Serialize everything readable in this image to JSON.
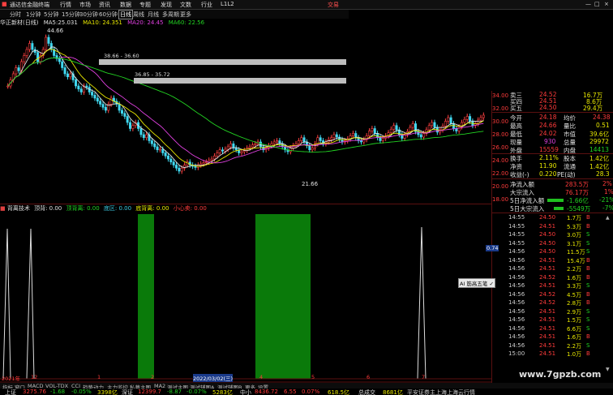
{
  "topbar": {
    "app_title": "通达信金融终端",
    "menus": [
      "行情",
      "市场",
      "资讯",
      "数据",
      "专题",
      "发现",
      "文数",
      "行业",
      "L1L2"
    ],
    "broker": "交易"
  },
  "periods": [
    "分时",
    "1分钟",
    "5分钟",
    "15分钟",
    "30分钟",
    "60分钟",
    "日线",
    "周线",
    "月线",
    "多周期",
    "更多"
  ],
  "active_period": "日线",
  "kline": {
    "title": "华正新材(日线)",
    "ma_label": "MA5:",
    "ma5": "25.031",
    "ma10": "MA10: 24.351",
    "ma20": "MA20: 24.45",
    "ma60": "MA60: 22.56",
    "high_label": "44.66",
    "low_label": "21.66",
    "zone1": "38.66 - 36.60",
    "zone2": "36.85 - 35.72",
    "axis": [
      "34.00",
      "32.00",
      "30.00",
      "28.00",
      "26.00",
      "24.00",
      "22.00",
      "20.00",
      "18.00"
    ],
    "closes": [
      36,
      37,
      38,
      39,
      38.5,
      40,
      41,
      42,
      43,
      42,
      41.5,
      40,
      41,
      42,
      44,
      43,
      42,
      41,
      40.5,
      40,
      39,
      38,
      37.5,
      38,
      37,
      36,
      35.5,
      35,
      36,
      35.8,
      35,
      34.5,
      34,
      33.5,
      33,
      32.5,
      32,
      33,
      34,
      33.5,
      33,
      32,
      31.5,
      31,
      30,
      29,
      29.5,
      30,
      29,
      28,
      27.5,
      28,
      27,
      26.5,
      26,
      25.5,
      25.6,
      25,
      24.5,
      24,
      23.5,
      23,
      22.5,
      22,
      22.5,
      23,
      23.5,
      23,
      22.8,
      22.6,
      23,
      23.2,
      23.4,
      23.5,
      23.8,
      24,
      24.5,
      25,
      25.5,
      25.3,
      25.6,
      26,
      26.5,
      25.8,
      25.5,
      25,
      25.2,
      25.4,
      25.8,
      26,
      26.3,
      26.5,
      26.8,
      26,
      25.5,
      25.8,
      26.2,
      26.5,
      26.8,
      27,
      26.5,
      26,
      25.5,
      25.2,
      25.8,
      26.2,
      26.5,
      27,
      27.5,
      26.8,
      26.2,
      25.5,
      25.8,
      26.5,
      27.5,
      27,
      26.5,
      26.8,
      27.2,
      27.5,
      28,
      27.6,
      27.2,
      26.8,
      27,
      27.3,
      27.8,
      28.2,
      27.5,
      27,
      26.8,
      27.2,
      27.8,
      28.6,
      29,
      28.2,
      27.5,
      27,
      27.4,
      27.8,
      28.3,
      28.9,
      29.5,
      28.8,
      28,
      27.4,
      28,
      28.5,
      29.2,
      29.8,
      28.5,
      28,
      27.6,
      28.2,
      28.8,
      29.5,
      30,
      29.2,
      28.4,
      28.8,
      29.4,
      30.2,
      30.8,
      29.8,
      29,
      28.6,
      29.3,
      30,
      30.5,
      31,
      30.2,
      29.5,
      29.8,
      30.4,
      30.8,
      31.2
    ]
  },
  "indicator": {
    "title": "背离技术",
    "items": [
      "顶背: 0.00",
      "顶背离: 0.00",
      "底区: 0.00",
      "底背离: 0.00",
      "小心卖: 0.00"
    ],
    "dates": [
      "2021年",
      "12",
      "1",
      "2",
      "2022/03/02(三)",
      "4",
      "5",
      "6",
      "7"
    ]
  },
  "quote": {
    "asks": [
      {
        "label": "卖三",
        "price": "24.52",
        "vol": "16.7万"
      },
      {
        "label": "买四",
        "price": "24.51",
        "vol": "8.6万"
      },
      {
        "label": "买五",
        "price": "24.50",
        "vol": "29.4万"
      }
    ],
    "stats": [
      {
        "l1": "今开",
        "v1": "24.18",
        "l2": "均价",
        "v2": "24.38"
      },
      {
        "l1": "最高",
        "v1": "24.66",
        "l2": "量比",
        "v2": "0.51"
      },
      {
        "l1": "最低",
        "v1": "24.02",
        "l2": "市值",
        "v2": "39.6亿"
      },
      {
        "l1": "现量",
        "v1": "930",
        "l2": "总量",
        "v2": "29972"
      },
      {
        "l1": "外盘",
        "v1": "15559",
        "l2": "内盘",
        "v2": "14413"
      },
      {
        "l1": "换手",
        "v1": "2.11%",
        "l2": "股本",
        "v2": "1.42亿"
      },
      {
        "l1": "净资",
        "v1": "11.90",
        "l2": "流通",
        "v2": "1.42亿"
      },
      {
        "l1": "收益(-)",
        "v1": "0.220",
        "l2": "PE(动)",
        "v2": "28.3"
      }
    ],
    "flows": [
      {
        "label": "净流入额",
        "v": "283.5万",
        "p": "2%"
      },
      {
        "label": "大宗流入",
        "v": "76.17万",
        "p": "1%"
      },
      {
        "label": "5日净流入额",
        "v": "-1.66亿",
        "p": "-21%"
      },
      {
        "label": "5日大宗流入",
        "v": "-5549万",
        "p": "-7%"
      }
    ],
    "ticks": [
      {
        "t": "14:55",
        "p": "24.50",
        "v": "1.7万",
        "s": "B"
      },
      {
        "t": "14:55",
        "p": "24.51",
        "v": "5.3万",
        "s": "B"
      },
      {
        "t": "14:55",
        "p": "24.50",
        "v": "3.0万",
        "s": "S"
      },
      {
        "t": "14:55",
        "p": "24.50",
        "v": "3.1万",
        "s": "S"
      },
      {
        "t": "14:56",
        "p": "24.50",
        "v": "11.5万",
        "s": "S"
      },
      {
        "t": "14:56",
        "p": "24.51",
        "v": "15.4万",
        "s": "B"
      },
      {
        "t": "14:56",
        "p": "24.51",
        "v": "2.2万",
        "s": "B"
      },
      {
        "t": "14:56",
        "p": "24.52",
        "v": "1.6万",
        "s": "B"
      },
      {
        "t": "14:56",
        "p": "24.51",
        "v": "3.3万",
        "s": "S"
      },
      {
        "t": "14:56",
        "p": "24.52",
        "v": "4.5万",
        "s": "B"
      },
      {
        "t": "14:56",
        "p": "24.52",
        "v": "2.8万",
        "s": "B"
      },
      {
        "t": "14:56",
        "p": "24.51",
        "v": "2.9万",
        "s": "S"
      },
      {
        "t": "14:56",
        "p": "24.51",
        "v": "1.5万",
        "s": "S"
      },
      {
        "t": "14:56",
        "p": "24.51",
        "v": "6.6万",
        "s": "S"
      },
      {
        "t": "14:56",
        "p": "24.51",
        "v": "1.6万",
        "s": "B"
      },
      {
        "t": "14:56",
        "p": "24.51",
        "v": "2.2万",
        "s": "S"
      },
      {
        "t": "15:00",
        "p": "24.51",
        "v": "1.0万",
        "s": "B"
      }
    ],
    "popup": "AI 筋高五笔 ✓",
    "mark": "0.74"
  },
  "tabs": [
    "扩展A",
    "关联报价",
    "资金分布",
    "综合资讯",
    "行业资讯",
    "互动问答",
    "背离技术",
    "主力监控",
    "私募主图",
    "MA2",
    "测试主图",
    "测试辅图A",
    "测试辅图B",
    "更多",
    "设置"
  ],
  "indicator_tabs": [
    "指标",
    "窗口",
    "MACD",
    "VOL-TDX",
    "CCI",
    "趋势动力",
    "主力监控",
    "私募主图",
    "MA2",
    "测试主图",
    "测试辅图A",
    "测试辅图B",
    "更多",
    "设置"
  ],
  "status": {
    "sh": "上证",
    "sh_v": "3275.76",
    "sh_c": "-1.68",
    "sh_p": "-0.05%",
    "sh_a": "3398亿",
    "sz": "深证",
    "sz_v": "12399.7",
    "sz_c": "-8.87",
    "sz_p": "-0.07%",
    "sz_a": "5283亿",
    "zx": "中小",
    "zx_v": "8436.72",
    "zx_c": "6.55",
    "zx_p": "0.07%",
    "zx_a": "618.5亿",
    "tot": "总成交",
    "tot_v": "8681亿",
    "broker": "平安证券主上海上海云行情"
  },
  "footer_right": "图文F10 数据",
  "watermark": "www.7gpzb.com"
}
